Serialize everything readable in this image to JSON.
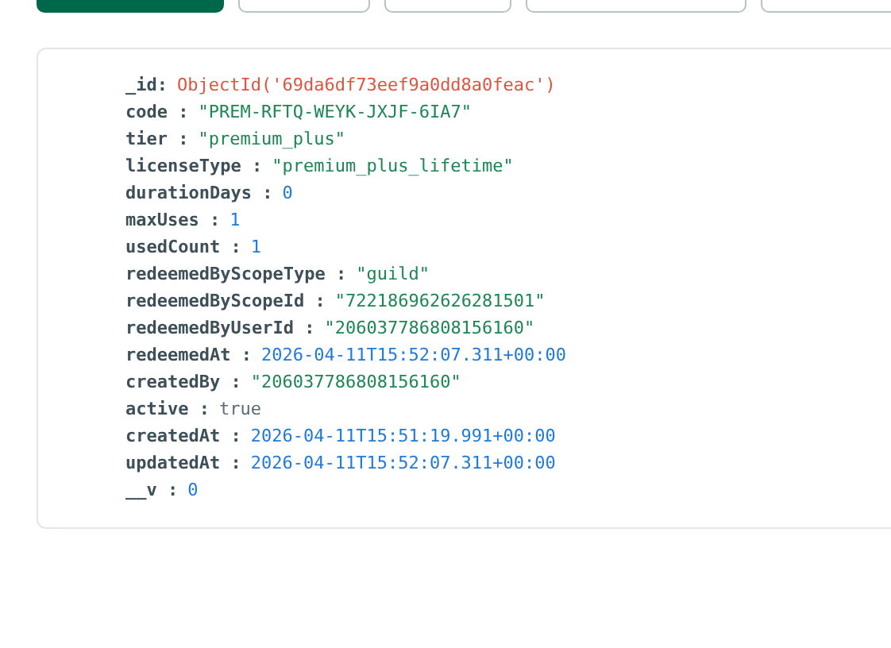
{
  "toolbar": {
    "buttons": [
      {
        "kind": "primary"
      },
      {
        "kind": "outline"
      },
      {
        "kind": "outline"
      },
      {
        "kind": "outline"
      },
      {
        "kind": "outline"
      }
    ]
  },
  "document": {
    "fields": [
      {
        "key": "_id:",
        "value": "ObjectId('69da6df73eef9a0dd8a0feac')",
        "kind": "objectid"
      },
      {
        "key": "code :",
        "value": "\"PREM-RFTQ-WEYK-JXJF-6IA7\"",
        "kind": "string"
      },
      {
        "key": "tier :",
        "value": "\"premium_plus\"",
        "kind": "string"
      },
      {
        "key": "licenseType :",
        "value": "\"premium_plus_lifetime\"",
        "kind": "string"
      },
      {
        "key": "durationDays :",
        "value": "0",
        "kind": "number"
      },
      {
        "key": "maxUses :",
        "value": "1",
        "kind": "number"
      },
      {
        "key": "usedCount :",
        "value": "1",
        "kind": "number"
      },
      {
        "key": "redeemedByScopeType :",
        "value": "\"guild\"",
        "kind": "string"
      },
      {
        "key": "redeemedByScopeId :",
        "value": "\"722186962626281501\"",
        "kind": "string"
      },
      {
        "key": "redeemedByUserId :",
        "value": "\"206037786808156160\"",
        "kind": "string"
      },
      {
        "key": "redeemedAt :",
        "value": "2026-04-11T15:52:07.311+00:00",
        "kind": "date"
      },
      {
        "key": "createdBy :",
        "value": "\"206037786808156160\"",
        "kind": "string"
      },
      {
        "key": "active :",
        "value": "true",
        "kind": "boolean"
      },
      {
        "key": "createdAt :",
        "value": "2026-04-11T15:51:19.991+00:00",
        "kind": "date"
      },
      {
        "key": "updatedAt :",
        "value": "2026-04-11T15:52:07.311+00:00",
        "kind": "date"
      },
      {
        "key": "__v :",
        "value": "0",
        "kind": "number"
      }
    ]
  }
}
